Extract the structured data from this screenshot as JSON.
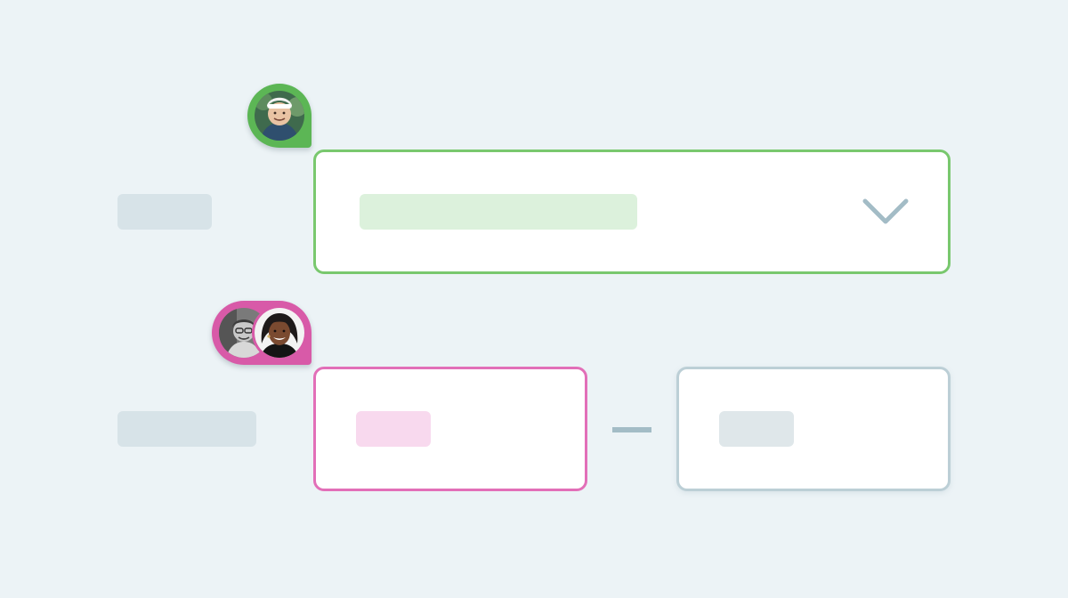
{
  "colors": {
    "background": "#ecf3f6",
    "label_placeholder": "#d7e3e8",
    "active_select_border": "#79c86e",
    "active_select_fill": "#dcf1dc",
    "active_date_border": "#e26fb8",
    "active_date_fill": "#f8d9ee",
    "inactive_border": "#bccfd6",
    "inactive_fill": "#dfe7ea",
    "chevron": "#a3bcc6",
    "presence_green": "#5cb655",
    "presence_pink": "#d85aa8"
  },
  "rows": [
    {
      "field_type": "dropdown-select",
      "icons": [
        "chevron-down-icon"
      ],
      "collaborator_count": 1
    },
    {
      "field_type": "range-input",
      "icons": [],
      "collaborator_count": 2
    }
  ]
}
